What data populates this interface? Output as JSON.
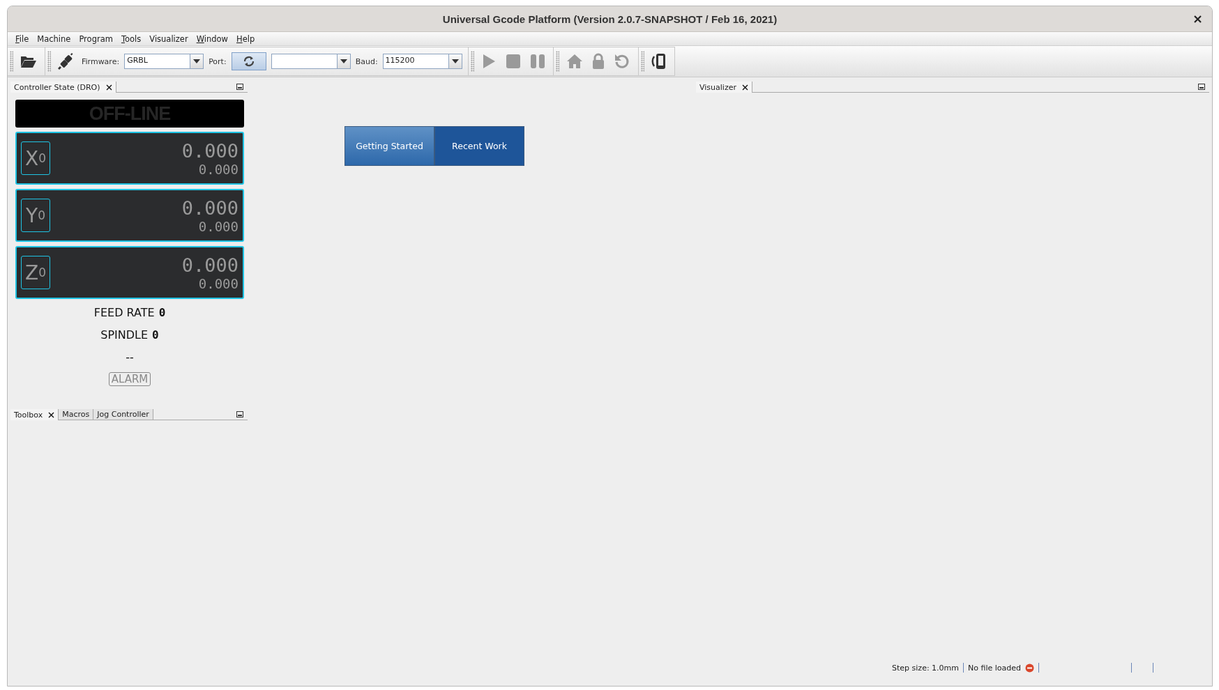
{
  "window": {
    "title": "Universal Gcode Platform (Version 2.0.7-SNAPSHOT / Feb 16, 2021)"
  },
  "menu": [
    {
      "label": "File",
      "mnemonic": true
    },
    {
      "label": "Machine",
      "mnemonic": false
    },
    {
      "label": "Program",
      "mnemonic": false
    },
    {
      "label": "Tools",
      "mnemonic": true
    },
    {
      "label": "Visualizer",
      "mnemonic": false
    },
    {
      "label": "Window",
      "mnemonic": true
    },
    {
      "label": "Help",
      "mnemonic": true
    }
  ],
  "toolbar": [
    [
      {
        "kind": "open",
        "disabled": false
      }
    ],
    [
      {
        "kind": "connect",
        "disabled": false
      },
      {
        "kind": "combo",
        "label": "Firmware:",
        "value": "GRBL"
      },
      {
        "kind": "refresh",
        "label": "Port:",
        "disabled": false
      },
      {
        "kind": "combo"
      },
      {
        "kind": "combo",
        "label": "Baud:",
        "value": "115200"
      }
    ],
    [
      {
        "kind": "play",
        "disabled": true
      },
      {
        "kind": "stop",
        "disabled": true
      },
      {
        "kind": "pause",
        "disabled": true
      }
    ],
    [
      {
        "kind": "home",
        "disabled": true
      },
      {
        "kind": "lock",
        "disabled": true
      },
      {
        "kind": "reset",
        "disabled": true
      }
    ],
    [
      {
        "kind": "pendant",
        "disabled": false
      }
    ]
  ],
  "dro_tabs": [
    {
      "label": "Controller State (DRO)",
      "selected": true,
      "closable": true
    }
  ],
  "dro": {
    "status": "OFF-LINE",
    "axes": [
      {
        "axis": "X",
        "index": "0",
        "work": "0.000",
        "machine": "0.000"
      },
      {
        "axis": "Y",
        "index": "0",
        "work": "0.000",
        "machine": "0.000"
      },
      {
        "axis": "Z",
        "index": "0",
        "work": "0.000",
        "machine": "0.000"
      }
    ],
    "feed_rate": {
      "label": "FEED RATE",
      "value": "0"
    },
    "spindle": {
      "label": "SPINDLE",
      "value": "0"
    },
    "state": "--",
    "alarm": {
      "label": "ALARM",
      "disabled": true
    }
  },
  "lower_tabs": [
    {
      "label": "Toolbox",
      "selected": true,
      "closable": true
    },
    {
      "label": "Macros",
      "selected": false,
      "closable": false
    },
    {
      "label": "Jog Controller",
      "selected": false,
      "closable": false
    }
  ],
  "visualizer_tabs": [
    {
      "label": "Visualizer",
      "selected": true,
      "closable": true
    }
  ],
  "start_page": [
    {
      "label": "Getting Started",
      "selected": true
    },
    {
      "label": "Recent Work",
      "selected": false
    }
  ],
  "status_bar": {
    "step_size": "Step size: 1.0mm",
    "file": "No file loaded",
    "file_error": true
  }
}
